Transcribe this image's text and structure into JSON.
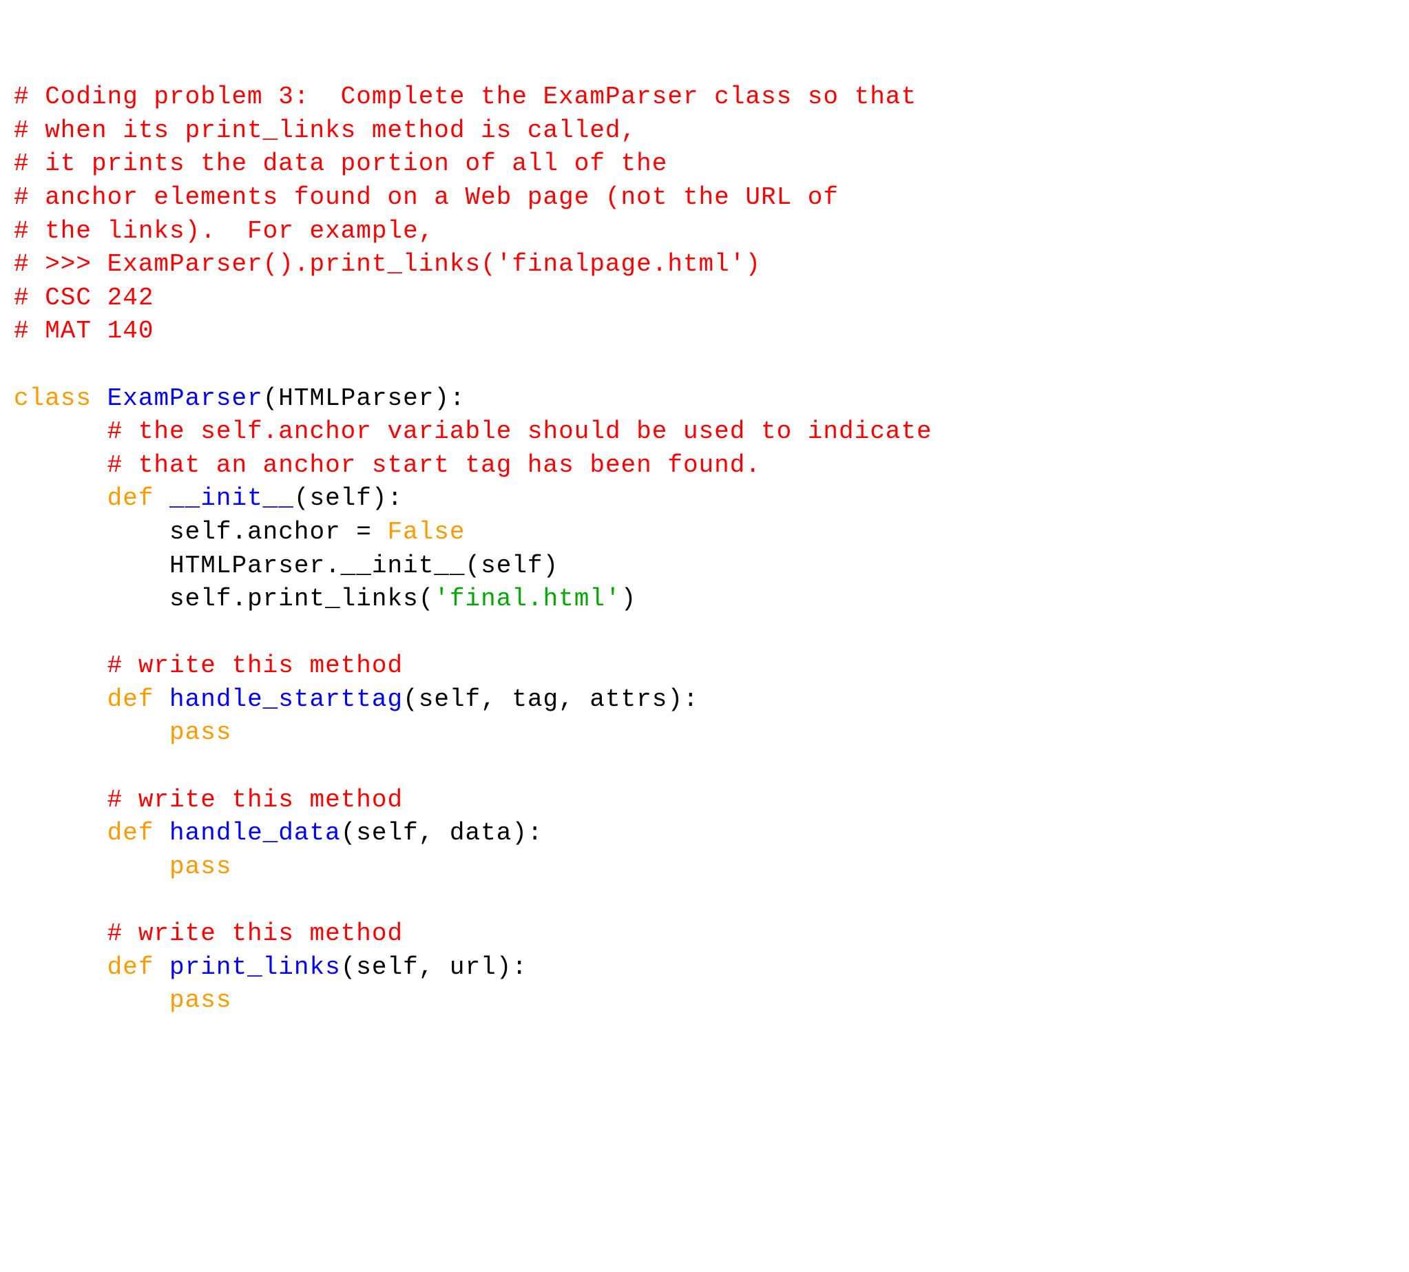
{
  "code": {
    "c1": "# Coding problem 3:  Complete the ExamParser class so that",
    "c2": "# when its print_links method is called,",
    "c3": "# it prints the data portion of all of the",
    "c4": "# anchor elements found on a Web page (not the URL of",
    "c5": "# the links).  For example,",
    "c6": "# >>> ExamParser().print_links('finalpage.html')",
    "c7": "# CSC 242",
    "c8": "# MAT 140",
    "blank1": "",
    "kw_class": "class",
    "sp": " ",
    "cls_name": "ExamParser",
    "paren_open": "(",
    "base": "HTMLParser",
    "paren_close_colon": "):",
    "indent1": "      ",
    "indent2": "          ",
    "c9": "# the self.anchor variable should be used to indicate",
    "c10": "# that an anchor start tag has been found.",
    "kw_def": "def",
    "m_init": "__init__",
    "sig_self": "(self):",
    "stmt1_a": "self.anchor = ",
    "kw_false": "False",
    "stmt2": "HTMLParser.__init__(self)",
    "stmt3_a": "self.print_links(",
    "str1": "'final.html'",
    "stmt3_b": ")",
    "c11": "# write this method",
    "m_hst": "handle_starttag",
    "sig_hst": "(self, tag, attrs):",
    "kw_pass": "pass",
    "c12": "# write this method",
    "m_hd": "handle_data",
    "sig_hd": "(self, data):",
    "c13": "# write this method",
    "m_pl": "print_links",
    "sig_pl": "(self, url):"
  }
}
